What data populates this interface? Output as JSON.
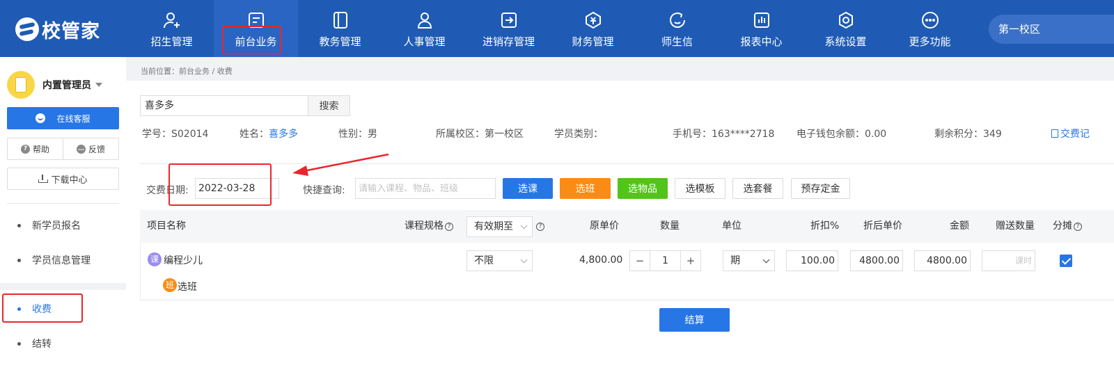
{
  "app": {
    "logo_text": "校管家"
  },
  "nav": {
    "items": [
      {
        "label": "招生管理",
        "icon": "add-user-icon"
      },
      {
        "label": "前台业务",
        "icon": "front-desk-icon"
      },
      {
        "label": "教务管理",
        "icon": "book-icon"
      },
      {
        "label": "人事管理",
        "icon": "person-icon"
      },
      {
        "label": "进销存管理",
        "icon": "inventory-icon"
      },
      {
        "label": "财务管理",
        "icon": "finance-icon"
      },
      {
        "label": "师生信",
        "icon": "chat-icon"
      },
      {
        "label": "报表中心",
        "icon": "report-icon"
      },
      {
        "label": "系统设置",
        "icon": "settings-icon"
      },
      {
        "label": "更多功能",
        "icon": "more-icon"
      }
    ],
    "active_index": 1,
    "campus": "第一校区"
  },
  "sidebar": {
    "user_name": "内置管理员",
    "service_label": "在线客服",
    "help_label": "帮助",
    "feedback_label": "反馈",
    "download_label": "下载中心",
    "menu": [
      {
        "label": "新学员报名"
      },
      {
        "label": "学员信息管理"
      },
      {
        "label": "收费"
      },
      {
        "label": "结转"
      }
    ]
  },
  "breadcrumb": "当前位置：前台业务 / 收费",
  "search": {
    "value": "喜多多",
    "button_label": "搜索"
  },
  "student": {
    "id_label": "学号：",
    "id_value": "S02014",
    "name_label": "姓名：",
    "name_value": "喜多多",
    "gender_label": "性别：",
    "gender_value": "男",
    "campus_label": "所属校区：",
    "campus_value": "第一校区",
    "category_label": "学员类别：",
    "phone_label": "手机号：",
    "phone_value": "163****2718",
    "wallet_label": "电子钱包余额：",
    "wallet_value": "0.00",
    "points_label": "剩余积分：",
    "points_value": "349",
    "record_link": "交费记"
  },
  "form": {
    "date_label": "交费日期:",
    "date_value": "2022-03-28",
    "quick_label": "快捷查询:",
    "quick_placeholder": "请输入课程、物品、班级"
  },
  "actions": {
    "course": "选课",
    "class": "选班",
    "goods": "选物品",
    "template": "选模板",
    "package": "选套餐",
    "deposit": "预存定金"
  },
  "table": {
    "headers": {
      "item_name": "项目名称",
      "spec": "课程规格",
      "validity": "有效期至",
      "unit_price": "原单价",
      "quantity": "数量",
      "unit": "单位",
      "discount": "折扣%",
      "discounted_price": "折后单价",
      "amount": "金额",
      "gift_qty": "赠送数量",
      "allocate": "分摊"
    },
    "row": {
      "course_badge": "课",
      "course_name": "编程少儿",
      "class_badge": "班",
      "class_action": "选班",
      "validity": "不限",
      "unit_price": "4,800.00",
      "quantity": "1",
      "minus": "−",
      "plus": "+",
      "unit": "期",
      "discount": "100.00",
      "discounted_price": "4800.00",
      "amount": "4800.00",
      "gift_placeholder": "课时",
      "allocate_checked": true
    }
  },
  "settle_label": "结算",
  "colors": {
    "nav_bg": "#1f5bb5",
    "primary": "#2776e6",
    "orange": "#fa8c16",
    "green": "#52c41a",
    "annotation_red": "#e8262b"
  }
}
